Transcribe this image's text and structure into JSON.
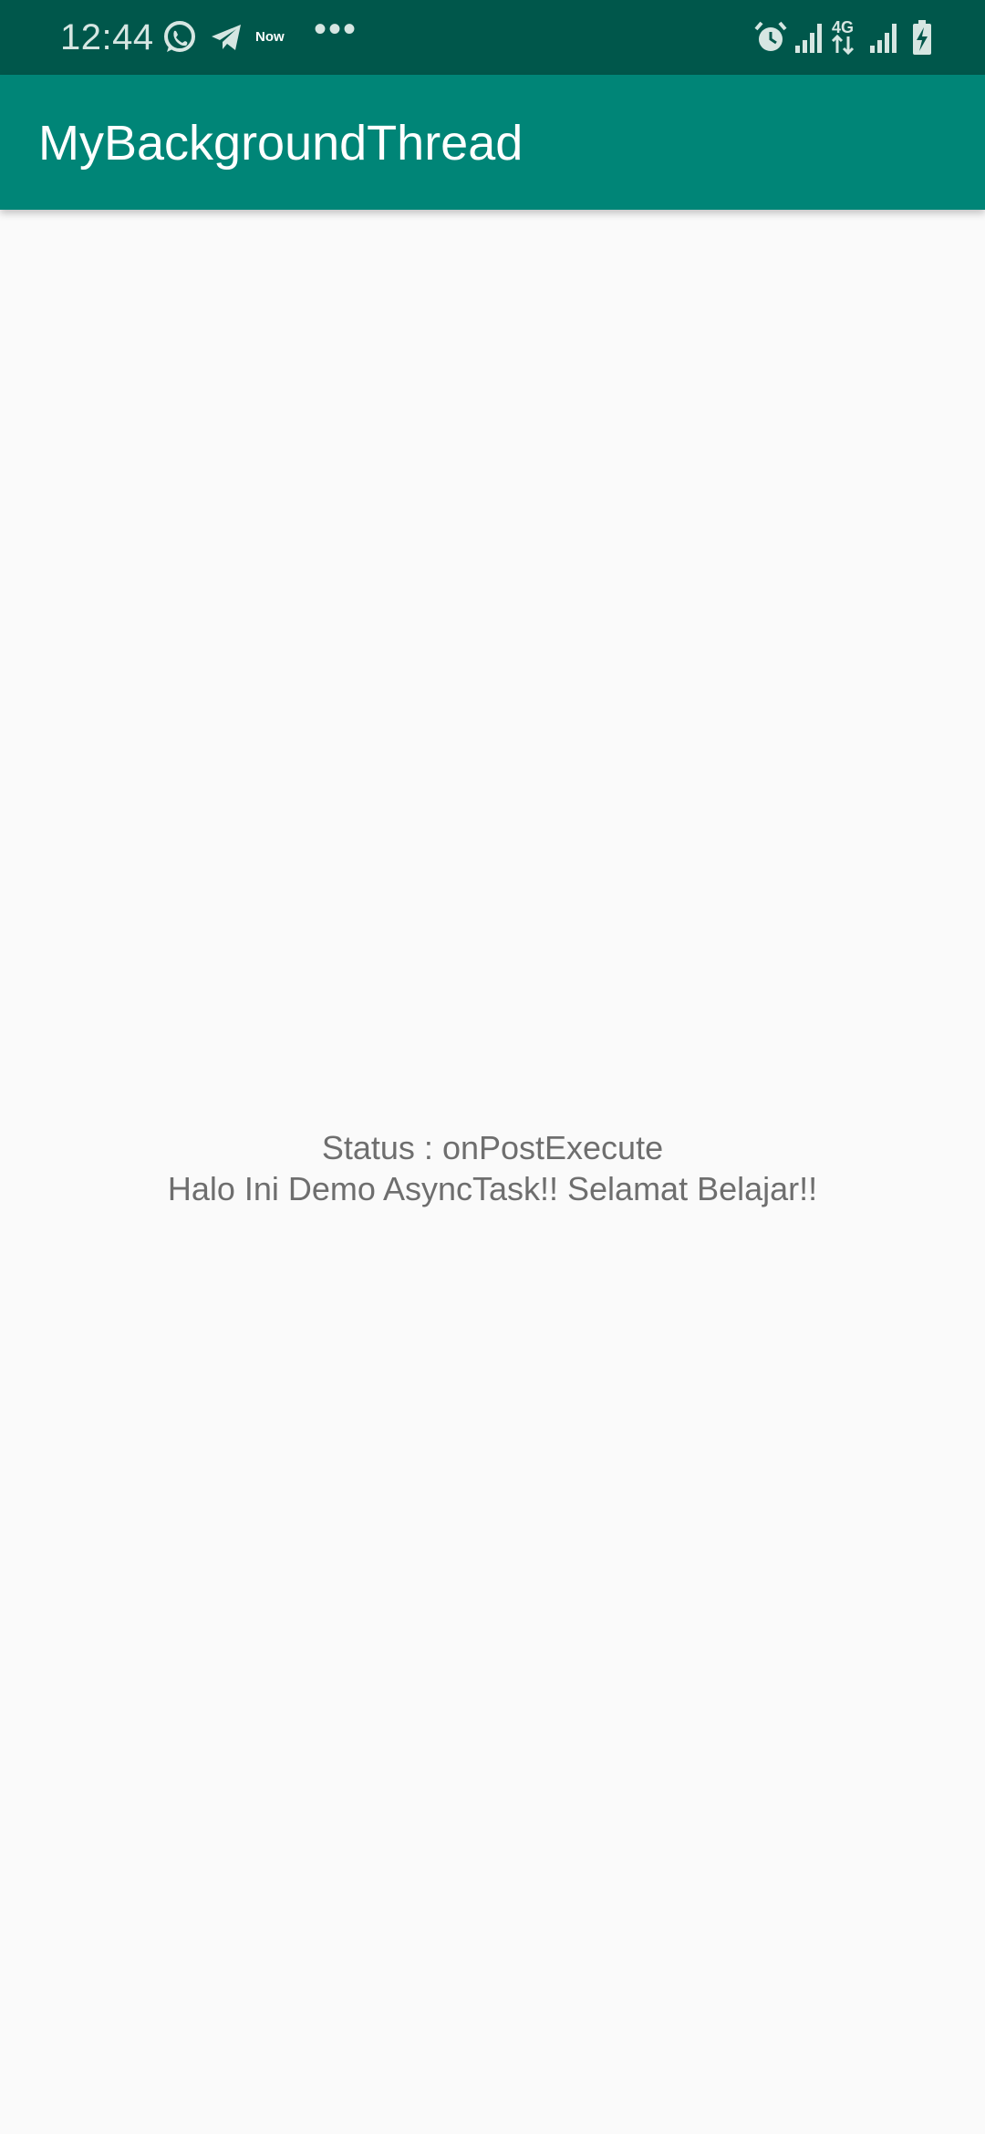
{
  "status_bar": {
    "time": "12:44",
    "notification_icons": [
      "whatsapp-icon",
      "telegram-icon",
      "now-icon",
      "more-dots-icon"
    ],
    "now_label": "Now",
    "dots": "•••",
    "system_icons": [
      "alarm-icon",
      "signal-icon",
      "4g-data-icon",
      "signal-icon",
      "battery-charging-icon"
    ],
    "network_label": "4G",
    "color": "#00574b"
  },
  "app_bar": {
    "title": "MyBackgroundThread",
    "color": "#008577"
  },
  "main": {
    "status_text": "Status : onPostExecute",
    "message_text": "Halo Ini Demo AsyncTask!! Selamat Belajar!!"
  }
}
